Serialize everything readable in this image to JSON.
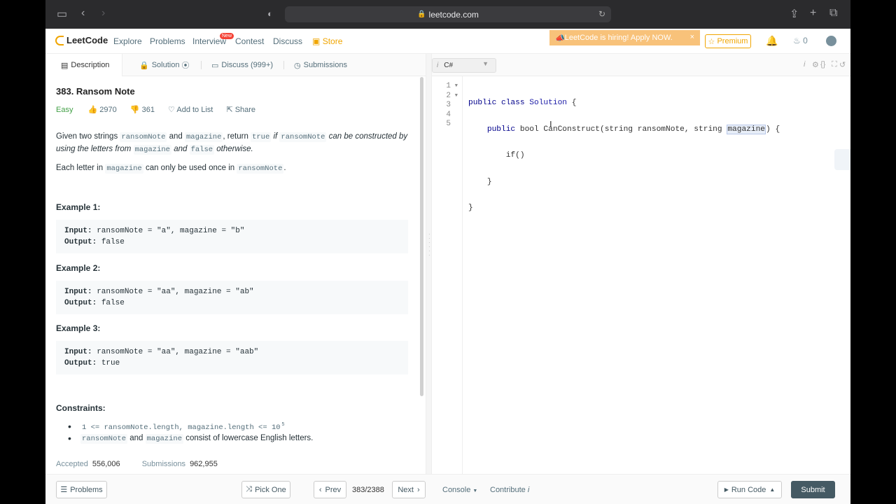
{
  "browser": {
    "url": "leetcode.com"
  },
  "nav": {
    "brand": "LeetCode",
    "items": [
      "Explore",
      "Problems",
      "Interview",
      "Contest",
      "Discuss"
    ],
    "new_badge": "New",
    "store": "Store",
    "hiring_banner": "LeetCode is hiring! Apply NOW.",
    "premium": "Premium",
    "streak_count": "0"
  },
  "tabs": {
    "description": "Description",
    "solution": "Solution",
    "discuss": "Discuss (999+)",
    "submissions": "Submissions"
  },
  "problem": {
    "title": "383. Ransom Note",
    "difficulty": "Easy",
    "likes": "2970",
    "dislikes": "361",
    "add_to_list": "Add to List",
    "share": "Share",
    "statement": {
      "t1": "Given two strings ",
      "c1": "ransomNote",
      "t2": " and ",
      "c2": "magazine",
      "t3": ", return ",
      "c3": "true",
      "t4": " if ",
      "c4": "ransomNote",
      "t5": " can be constructed by using the letters from ",
      "c5": "magazine",
      "t6": " and ",
      "c6": "false",
      "t7": " otherwise."
    },
    "statement2": {
      "t1": "Each letter in ",
      "c1": "magazine",
      "t2": " can only be used once in ",
      "c2": "ransomNote",
      "t3": "."
    },
    "examples": [
      {
        "heading": "Example 1:",
        "input_label": "Input:",
        "input": " ransomNote = \"a\", magazine = \"b\"",
        "output_label": "Output:",
        "output": " false"
      },
      {
        "heading": "Example 2:",
        "input_label": "Input:",
        "input": " ransomNote = \"aa\", magazine = \"ab\"",
        "output_label": "Output:",
        "output": " false"
      },
      {
        "heading": "Example 3:",
        "input_label": "Input:",
        "input": " ransomNote = \"aa\", magazine = \"aab\"",
        "output_label": "Output:",
        "output": " true"
      }
    ],
    "constraints_heading": "Constraints:",
    "constraint1": "1 <= ransomNote.length, magazine.length <= 10",
    "constraint1_sup": "5",
    "constraint2": {
      "c1": "ransomNote",
      "t1": " and ",
      "c2": "magazine",
      "t2": " consist of lowercase English letters."
    },
    "accepted_label": "Accepted",
    "accepted_value": "556,006",
    "submissions_label": "Submissions",
    "submissions_value": "962,955"
  },
  "editor": {
    "language": "C#",
    "line_numbers": [
      "1",
      "2",
      "3",
      "4",
      "5"
    ],
    "code": {
      "l1a": "public class ",
      "l1b": "Solution",
      "l1c": " {",
      "l2a": "    public ",
      "l2b": "bool",
      "l2c": " CanConstruct(",
      "l2d": "string",
      "l2e": " ransomNote, ",
      "l2f": "string",
      "l2g": " ",
      "l2h": "magazine",
      "l2i": ") {",
      "l3": "        if()",
      "l4": "    }",
      "l5": "}"
    }
  },
  "bottom": {
    "problems": "Problems",
    "pick_one": "Pick One",
    "prev": "Prev",
    "page": "383/2388",
    "next": "Next",
    "console": "Console",
    "contribute": "Contribute",
    "run_code": "Run Code",
    "submit": "Submit"
  }
}
